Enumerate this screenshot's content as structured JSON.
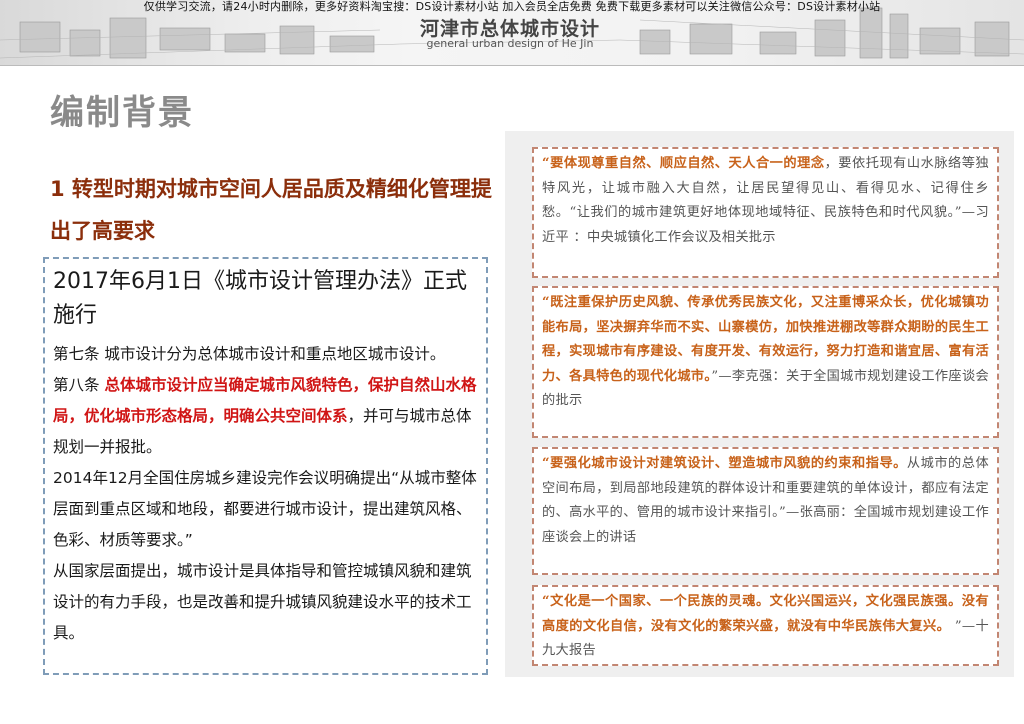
{
  "header": {
    "notice": "仅供学习交流，请24小时内删除，更多好资料淘宝搜：DS设计素材小站  加入会员全店免费  免费下载更多素材可以关注微信公众号：DS设计素材小站",
    "brand_cn": "河津市总体城市设计",
    "brand_en": "general urban design of He Jin"
  },
  "page_title": "编制背景",
  "section": {
    "heading": "1 转型时期对城市空间人居品质及精细化管理提出了高要求"
  },
  "left_box": {
    "title": "2017年6月1日《城市设计管理办法》正式施行",
    "para1": "第七条 城市设计分为总体城市设计和重点地区城市设计。",
    "para2_prefix": "第八条 ",
    "para2_red": "总体城市设计应当确定城市风貌特色，保护自然山水格局，优化城市形态格局，明确公共空间体系",
    "para2_suffix": "，并可与城市总体规划一并报批。",
    "para3": "2014年12月全国住房城乡建设完作会议明确提出“从城市整体层面到重点区域和地段，都要进行城市设计，提出建筑风格、色彩、材质等要求。”",
    "para4": "从国家层面提出，城市设计是具体指导和管控城镇风貌和建筑设计的有力手段，也是改善和提升城镇风貌建设水平的技术工具。"
  },
  "quotes": [
    {
      "highlight": "“要体现尊重自然、顺应自然、天人合一的理念",
      "text": "，要依托现有山水脉络等独特风光，让城市融入大自然，让居民望得见山、看得见水、记得住乡愁。“让我们的城市建筑更好地体现地域特征、民族特色和时代风貌。”—习近平 ：中央城镇化工作会议及相关批示"
    },
    {
      "highlight": "“既注重保护历史风貌、传承优秀民族文化，又注重博采众长，优化城镇功能布局，坚决摒弃华而不实、山寨模仿，加快推进棚改等群众期盼的民生工程，实现城市有序建设、有度开发、有效运行，努力打造和谐宜居、富有活力、各具特色的现代化城市。",
      "text": "”—李克强：关于全国城市规划建设工作座谈会的批示"
    },
    {
      "highlight": "“要强化城市设计对建筑设计、塑造城市风貌的约束和指导。",
      "text": "从城市的总体空间布局，到局部地段建筑的群体设计和重要建筑的单体设计，都应有法定的、高水平的、管用的城市设计来指引。”—张高丽：全国城市规划建设工作座谈会上的讲话"
    },
    {
      "highlight": "“文化是一个国家、一个民族的灵魂。文化兴国运兴，文化强民族强。没有高度的文化自信，没有文化的繁荣兴盛，就没有中华民族伟大复兴。",
      "text": " ”—十九大报告"
    }
  ],
  "colors": {
    "heading_red": "#8b2e0b",
    "emphasis_red": "#d01515",
    "quote_highlight": "#c8621a",
    "left_border": "#7f9cb8",
    "quote_border": "#c28672"
  }
}
